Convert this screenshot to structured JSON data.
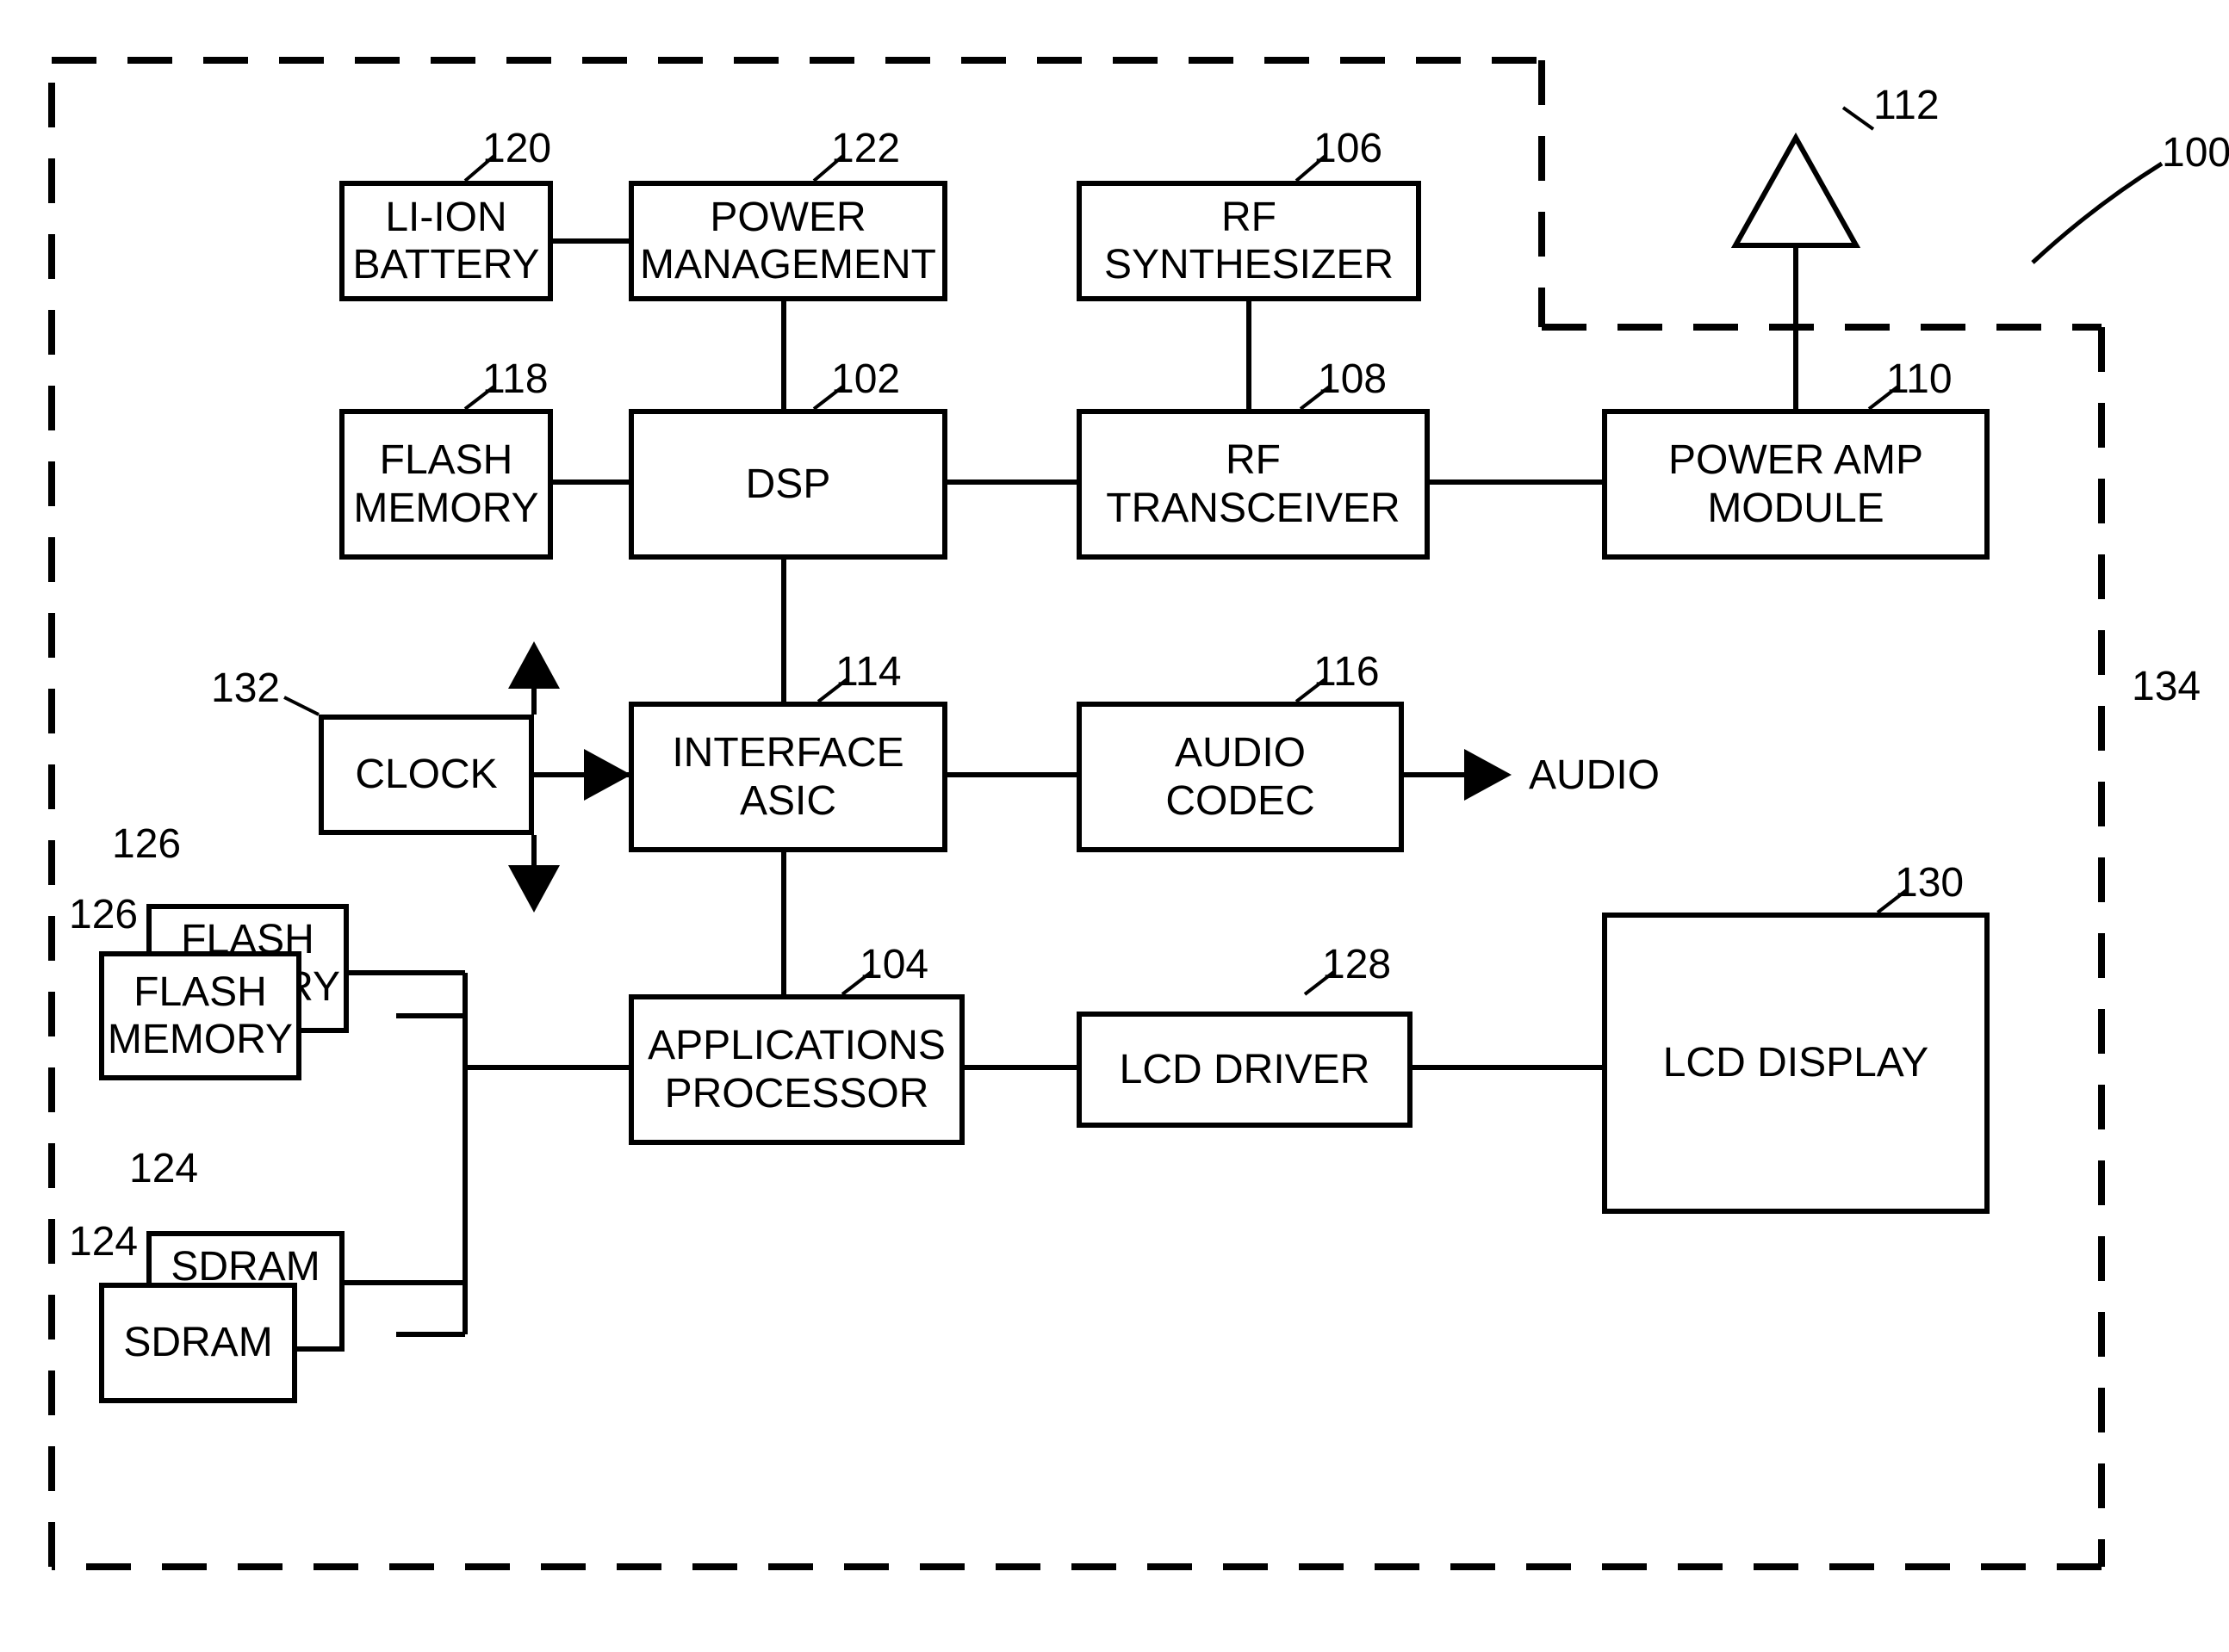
{
  "refs": {
    "system": "100",
    "dsp": "102",
    "app_proc": "104",
    "rf_synth": "106",
    "rf_trx": "108",
    "pa_module": "110",
    "antenna": "112",
    "iface_asic": "114",
    "audio_codec": "116",
    "flash_mem": "118",
    "battery": "120",
    "pwr_mgmt": "122",
    "sdram_a": "124",
    "sdram_b": "124",
    "flash_a": "126",
    "flash_b": "126",
    "lcd_driver": "128",
    "lcd_display": "130",
    "clock": "132",
    "boundary": "134"
  },
  "blocks": {
    "battery": "LI-ION\nBATTERY",
    "pwr_mgmt": "POWER\nMANAGEMENT",
    "rf_synth": "RF\nSYNTHESIZER",
    "flash_mem": "FLASH\nMEMORY",
    "dsp": "DSP",
    "rf_trx": "RF\nTRANSCEIVER",
    "pa_module": "POWER AMP\nMODULE",
    "clock": "CLOCK",
    "iface_asic": "INTERFACE\nASIC",
    "audio_codec": "AUDIO\nCODEC",
    "app_proc": "APPLICATIONS\nPROCESSOR",
    "lcd_driver": "LCD DRIVER",
    "lcd_display": "LCD DISPLAY",
    "flash_stack_back": "FLASH\nMEMORY",
    "flash_stack_front": "FLASH\nMEMORY",
    "sdram_back": "SDRAM",
    "sdram_front": "SDRAM"
  },
  "outputs": {
    "audio": "AUDIO"
  }
}
